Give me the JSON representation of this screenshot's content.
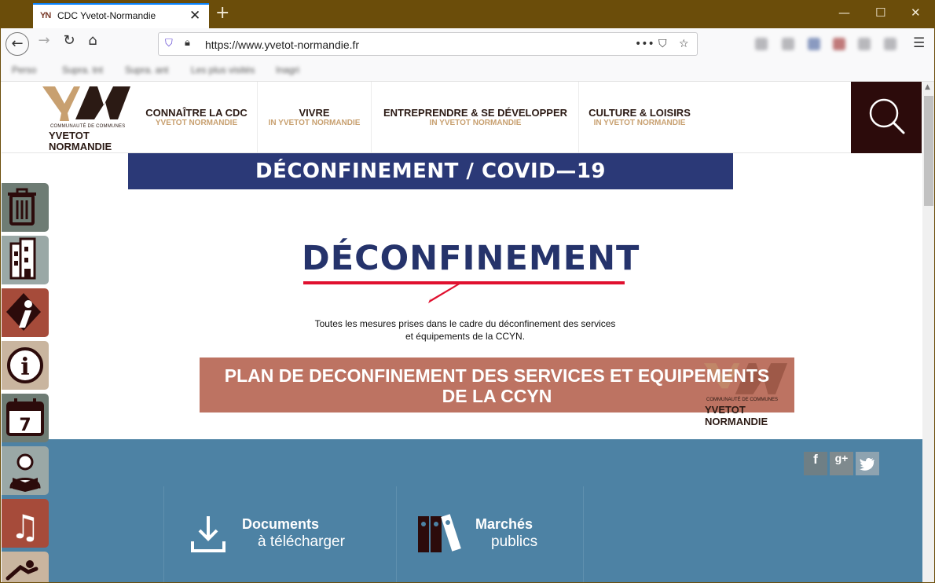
{
  "browser": {
    "tab_title": "CDC Yvetot-Normandie",
    "tab_favicon": "YN",
    "url": "https://www.yvetot-normandie.fr",
    "bookmarks": [
      "Perso",
      "Supra. tnt",
      "Supra. ant",
      "Les plus visités",
      "Inagri"
    ]
  },
  "site": {
    "logo": {
      "small": "COMMUNAUTÉ DE COMMUNES",
      "line1": "YVETOT",
      "line2": "NORMANDIE"
    },
    "menu": [
      {
        "main": "CONNAÎTRE LA CDC",
        "sub": "YVETOT NORMANDIE"
      },
      {
        "main": "VIVRE",
        "sub": "IN YVETOT NORMANDIE"
      },
      {
        "main": "ENTREPRENDRE & SE DÉVELOPPER",
        "sub": "IN YVETOT NORMANDIE"
      },
      {
        "main": "CULTURE & LOISIRS",
        "sub": "IN YVETOT NORMANDIE"
      }
    ],
    "banner": "DÉCONFINEMENT / COVID—19",
    "deconf_title": "DÉCONFINEMENT",
    "description_line1": "Toutes les mesures prises dans le cadre du déconfinement des services",
    "description_line2": "et équipements de la CCYN.",
    "plan_line1": "PLAN DE DECONFINEMENT DES SERVICES ET EQUIPEMENTS",
    "plan_line2": "DE LA CCYN",
    "plan_logo": {
      "small": "COMMUNAUTÉ DE COMMUNES",
      "line1": "YVETOT",
      "line2": "NORMANDIE"
    },
    "social": [
      "f",
      "g+",
      "twitter"
    ],
    "quick_links": [
      {
        "title": "Documents",
        "sub": "à télécharger",
        "icon": "download-icon"
      },
      {
        "title": "Marchés",
        "sub": "publics",
        "icon": "binders-icon"
      }
    ],
    "sidebar_icons": [
      "trash-icon",
      "building-icon",
      "tourism-icon",
      "info-icon",
      "calendar-icon",
      "reader-icon",
      "music-icon",
      "swimmer-icon"
    ],
    "calendar_day": "7",
    "info_letter": "i"
  },
  "colors": {
    "titlebar": "#6b4d0a",
    "brand_dark": "#2b1a14",
    "brand_gold": "#c8a070",
    "banner_blue": "#2b3977",
    "plan_terracotta": "#bd7362",
    "section_blue": "#4d82a4",
    "sidebar": [
      "#6e7c74",
      "#9aa8a6",
      "#a64b3a",
      "#c9b59f",
      "#6e7c74",
      "#9aa8a6",
      "#a64b3a",
      "#c9b59f"
    ]
  }
}
